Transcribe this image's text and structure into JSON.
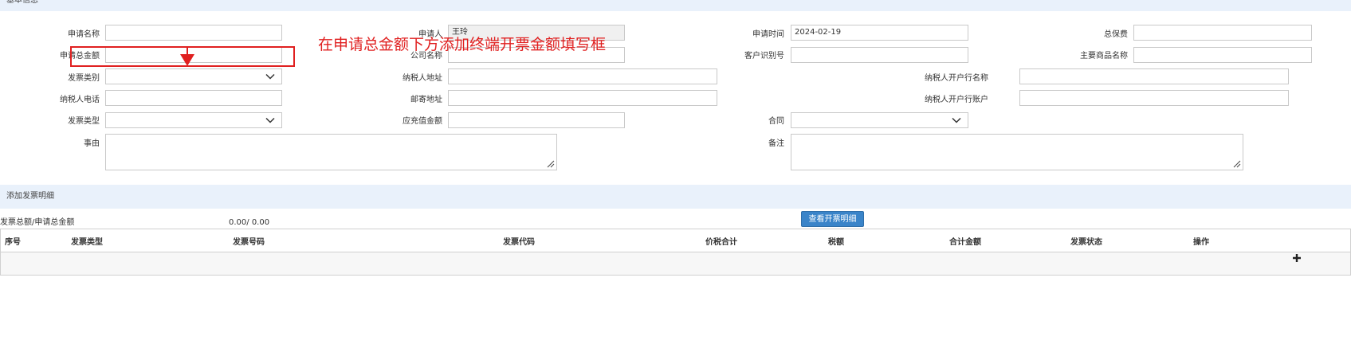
{
  "sections": {
    "basic_info": "基本信息",
    "add_invoice_detail": "添加发票明细"
  },
  "form": {
    "apply_name_label": "申请名称",
    "applicant_label": "申请人",
    "applicant_value": "王玲",
    "apply_time_label": "申请时间",
    "apply_time_value": "2024-02-19",
    "total_fee_label": "总保费",
    "apply_total_label": "申请总金额",
    "company_name_label": "公司名称",
    "customer_id_label": "客户识别号",
    "main_product_label": "主要商品名称",
    "invoice_category_label": "发票类别",
    "taxpayer_address_label": "纳税人地址",
    "taxpayer_bank_name_label": "纳税人开户行名称",
    "taxpayer_phone_label": "纳税人电话",
    "mail_address_label": "邮寄地址",
    "taxpayer_bank_account_label": "纳税人开户行账户",
    "invoice_type_label": "发票类型",
    "prepaid_amount_label": "应充值金额",
    "contract_label": "合同",
    "reason_label": "事由",
    "remark_label": "备注"
  },
  "annotation": {
    "text": "在申请总金额下方添加终端开票金额填写框",
    "color": "#e02020"
  },
  "invoice": {
    "summary_label": "发票总额/申请总金额",
    "summary_value": "0.00/ 0.00",
    "view_button": "查看开票明细"
  },
  "table": {
    "columns": [
      "序号",
      "发票类型",
      "发票号码",
      "发票代码",
      "价税合计",
      "税额",
      "合计金额",
      "发票状态",
      "操作"
    ]
  },
  "icons": {
    "select_arrow": "chevron-down-icon",
    "resize": "resize-grip-icon",
    "add": "plus-icon"
  },
  "colors": {
    "section_bar": "#e9f1fb",
    "button": "#3a84c9",
    "annotation": "#e02020"
  }
}
